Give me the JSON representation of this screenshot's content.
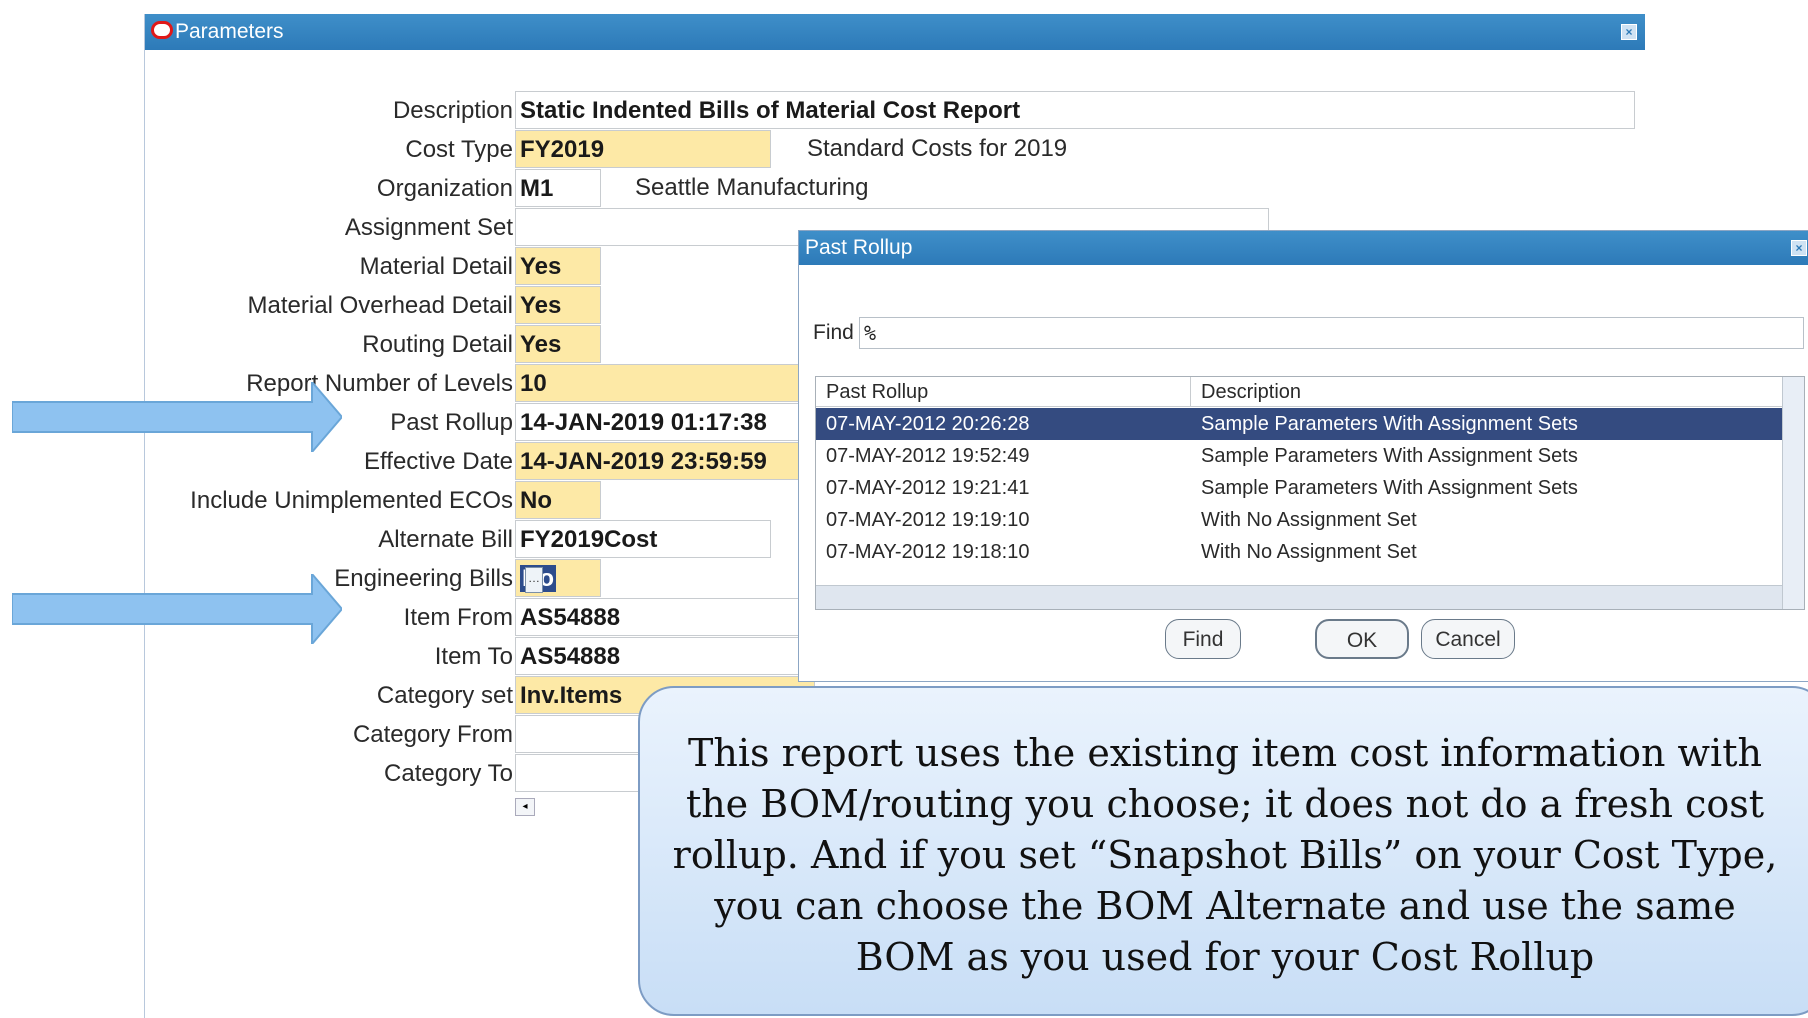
{
  "window": {
    "title": "Parameters",
    "close_icon": "×"
  },
  "form": {
    "description": {
      "label": "Description",
      "value": "Static Indented Bills of Material Cost Report"
    },
    "cost_type": {
      "label": "Cost Type",
      "value": "FY2019",
      "desc": "Standard Costs for 2019"
    },
    "organization": {
      "label": "Organization",
      "value": "M1",
      "desc": "Seattle Manufacturing"
    },
    "assignment_set": {
      "label": "Assignment Set",
      "value": ""
    },
    "material_detail": {
      "label": "Material Detail",
      "value": "Yes"
    },
    "material_overhead_detail": {
      "label": "Material Overhead Detail",
      "value": "Yes"
    },
    "routing_detail": {
      "label": "Routing Detail",
      "value": "Yes"
    },
    "report_levels": {
      "label": "Report Number of Levels",
      "value": "10"
    },
    "past_rollup": {
      "label": "Past Rollup",
      "value": "14-JAN-2019 01:17:38"
    },
    "effective_date": {
      "label": "Effective Date",
      "value": "14-JAN-2019 23:59:59"
    },
    "include_ecos": {
      "label": "Include Unimplemented ECOs",
      "value": "No"
    },
    "alternate_bill": {
      "label": "Alternate Bill",
      "value": "FY2019Cost"
    },
    "engineering_bills": {
      "label": "Engineering Bills",
      "value": "No"
    },
    "item_from": {
      "label": "Item From",
      "value": "AS54888"
    },
    "item_to": {
      "label": "Item To",
      "value": "AS54888"
    },
    "category_set": {
      "label": "Category set",
      "value": "Inv.Items"
    },
    "category_from": {
      "label": "Category From",
      "value": ""
    },
    "category_to": {
      "label": "Category To",
      "value": ""
    }
  },
  "popup": {
    "title": "Past Rollup",
    "find_label": "Find",
    "find_value": "%",
    "columns": [
      "Past Rollup",
      "Description"
    ],
    "rows": [
      {
        "rollup": "07-MAY-2012 20:26:28",
        "description": "Sample Parameters With Assignment Sets"
      },
      {
        "rollup": "07-MAY-2012 19:52:49",
        "description": "Sample Parameters With Assignment Sets"
      },
      {
        "rollup": "07-MAY-2012 19:21:41",
        "description": "Sample Parameters With Assignment Sets"
      },
      {
        "rollup": "07-MAY-2012 19:19:10",
        "description": "With No Assignment Set"
      },
      {
        "rollup": "07-MAY-2012 19:18:10",
        "description": "With No Assignment Set"
      }
    ],
    "buttons": {
      "find": "Find",
      "ok": "OK",
      "cancel": "Cancel"
    },
    "selected_row": 0
  },
  "callout": {
    "text": "This report uses the existing item cost information with the BOM/routing you choose; it does not do a fresh cost rollup. And if you set “Snapshot Bills” on your Cost Type, you can choose the BOM Alternate and use the same BOM as you used for your Cost Rollup"
  },
  "colors": {
    "titlebar": "#2d7ab8",
    "required_field": "#fde9a6",
    "selection": "#344b80",
    "arrow": "#8ec2f0"
  }
}
